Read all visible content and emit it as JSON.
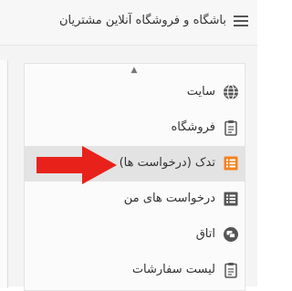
{
  "header": {
    "title": "باشگاه و فروشگاه آنلاین مشتریان",
    "menu_icon": "hamburger-icon"
  },
  "menu": {
    "items": [
      {
        "label": "سایت",
        "icon": "globe-icon",
        "active": false
      },
      {
        "label": "فروشگاه",
        "icon": "clipboard-icon",
        "active": false
      },
      {
        "label": "تدک (درخواست ها)",
        "icon": "list-icon",
        "active": true
      },
      {
        "label": "درخواست های من",
        "icon": "list-icon",
        "active": false
      },
      {
        "label": "اتاق",
        "icon": "chat-icon",
        "active": false
      },
      {
        "label": "لیست سفارشات",
        "icon": "clipboard-icon",
        "active": false
      }
    ]
  },
  "colors": {
    "accent_orange": "#f58220",
    "arrow_red": "#e8221b",
    "icon_gray": "#555555"
  }
}
